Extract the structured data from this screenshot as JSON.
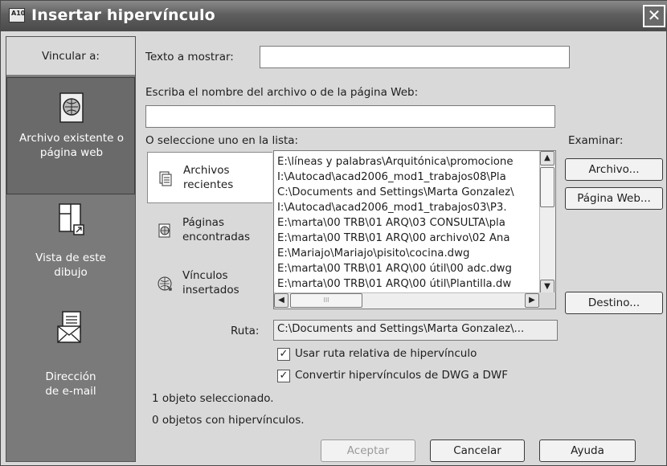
{
  "window": {
    "title": "Insertar hipervínculo",
    "icon_text": "A10",
    "close_symbol": "✕"
  },
  "sidebar": {
    "header": "Vincular a:",
    "items": [
      {
        "label_line1": "Archivo existente o",
        "label_line2": "página web",
        "icon": "globe-page-icon",
        "selected": true
      },
      {
        "label_line1": "Vista de este",
        "label_line2": "dibujo",
        "icon": "drawing-view-icon",
        "selected": false
      },
      {
        "label_line1": "Dirección",
        "label_line2": "de e-mail",
        "icon": "email-icon",
        "selected": false
      }
    ]
  },
  "form": {
    "display_text_label": "Texto a mostrar:",
    "display_text_value": "",
    "filename_label": "Escriba el nombre del archivo o de la página Web:",
    "filename_value": "",
    "select_list_label": "O seleccione uno en la lista:",
    "browse_label": "Examinar:",
    "path_label": "Ruta:",
    "path_value": "C:\\Documents and Settings\\Marta Gonzalez\\...",
    "relative_path_label": "Usar ruta relativa de hipervínculo",
    "relative_path_checked": true,
    "convert_label": "Convertir hipervínculos de DWG a DWF",
    "convert_checked": true,
    "status_line1": "1 objeto seleccionado.",
    "status_line2": "0 objetos con hipervínculos."
  },
  "tabs": [
    {
      "line1": "Archivos",
      "line2": "recientes",
      "icon": "recent-files-icon",
      "selected": true
    },
    {
      "line1": "Páginas",
      "line2": "encontradas",
      "icon": "browsed-pages-icon",
      "selected": false
    },
    {
      "line1": "Vínculos",
      "line2": "insertados",
      "icon": "inserted-links-icon",
      "selected": false
    }
  ],
  "file_list": [
    "E:\\líneas y palabras\\Arquitónica\\promocione",
    "I:\\Autocad\\acad2006_mod1_trabajos08\\Pla",
    "C:\\Documents and Settings\\Marta Gonzalez\\",
    "I:\\Autocad\\acad2006_mod1_trabajos03\\P3.",
    "E:\\marta\\00 TRB\\01 ARQ\\03 CONSULTA\\pla",
    "E:\\marta\\00 TRB\\01 ARQ\\00 archivo\\02 Ana",
    "E:\\Mariajo\\Mariajo\\pisito\\cocina.dwg",
    "E:\\marta\\00 TRB\\01 ARQ\\00 útil\\00 adc.dwg",
    "E:\\marta\\00 TRB\\01 ARQ\\00 útil\\Plantilla.dw"
  ],
  "buttons": {
    "archivo": "Archivo...",
    "pagina_web": "Página Web...",
    "destino": "Destino...",
    "aceptar": "Aceptar",
    "cancelar": "Cancelar",
    "ayuda": "Ayuda"
  },
  "scroll": {
    "up": "▲",
    "down": "▼",
    "left": "◀",
    "right": "▶",
    "grip": "III"
  }
}
